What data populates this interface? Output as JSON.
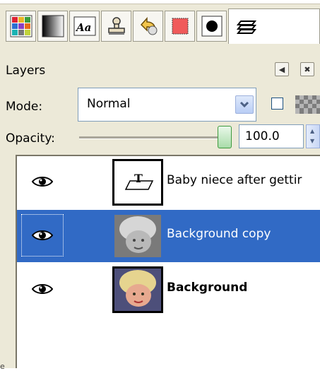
{
  "tabs": [
    {
      "icon": "palette-grid-icon"
    },
    {
      "icon": "gradient-icon"
    },
    {
      "icon": "font-icon",
      "text": "Aa"
    },
    {
      "icon": "stamp-icon"
    },
    {
      "icon": "undo-history-icon"
    },
    {
      "icon": "pattern-icon"
    },
    {
      "icon": "brush-icon"
    },
    {
      "icon": "layers-icon"
    }
  ],
  "panel": {
    "title": "Layers",
    "mode_label": "Mode:",
    "mode_value": "Normal",
    "opacity_label": "Opacity:",
    "opacity_value": "100.0",
    "opacity_level": 1.0
  },
  "layers": [
    {
      "name": "Baby niece after gettir",
      "visible": true,
      "selected": false,
      "bold": false,
      "thumb": "text-layer-thumbnail"
    },
    {
      "name": "Background copy",
      "visible": true,
      "selected": true,
      "bold": false,
      "thumb": "grayscale-photo-thumbnail"
    },
    {
      "name": "Background",
      "visible": true,
      "selected": false,
      "bold": true,
      "thumb": "color-photo-thumbnail"
    }
  ],
  "colors": {
    "selection": "#316ac5",
    "panel_bg": "#ece9d8",
    "slider_thumb": "#3d9a3d"
  },
  "footer_mark": "e"
}
